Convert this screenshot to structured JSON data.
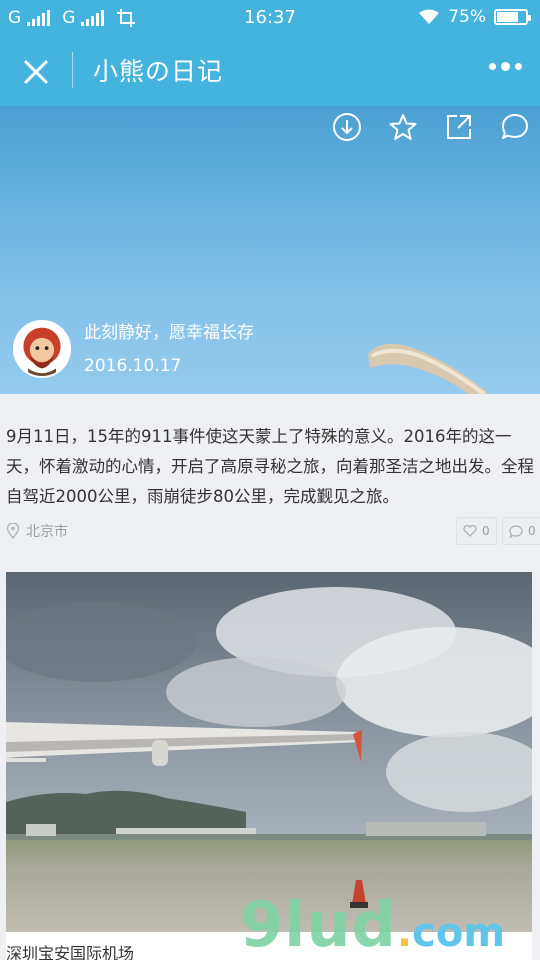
{
  "status_bar": {
    "carrier1": "G",
    "carrier2": "G",
    "time": "16:37",
    "battery": "75%",
    "battery_level": 0.75
  },
  "nav": {
    "title": "小熊の日记"
  },
  "hero": {
    "motto": "此刻静好，愿幸福长存",
    "date": "2016.10.17"
  },
  "post": {
    "text": "9月11日，15年的911事件使这天蒙上了特殊的意义。2016年的这一天，怀着激动的心情，开启了高原寻秘之旅，向着那圣洁之地出发。全程自驾近2000公里，雨崩徒步80公里，完成觐见之旅。",
    "location": "北京市",
    "likes": "0",
    "comments": "0"
  },
  "photo": {
    "caption": "深圳宝安国际机场"
  },
  "watermark": {
    "brand": "9lud",
    "dot": ".",
    "tld": "com"
  },
  "colors": {
    "accent": "#44b4de",
    "background": "#eef0f3"
  }
}
